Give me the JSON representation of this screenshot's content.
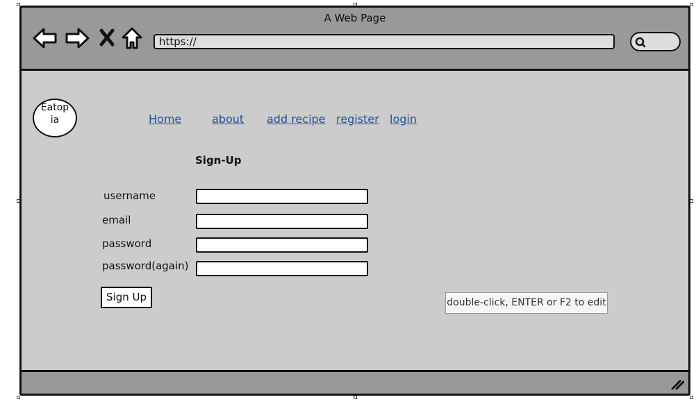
{
  "window": {
    "title": "A Web Page"
  },
  "toolbar": {
    "url": "https://",
    "icons": [
      "back-arrow-icon",
      "forward-arrow-icon",
      "close-x-icon",
      "home-icon",
      "search-icon"
    ]
  },
  "logo": {
    "text_line1": "Eatop",
    "text_line2": "ia"
  },
  "nav": {
    "home": "Home",
    "about": "about",
    "add_recipe": "add recipe",
    "register": "register",
    "login": "login"
  },
  "form": {
    "heading": "Sign-Up",
    "username_label": "username",
    "email_label": "email",
    "password_label": "password",
    "password_again_label": "password(again)",
    "username_value": "",
    "email_value": "",
    "password_value": "",
    "password_again_value": "",
    "submit_label": "Sign Up"
  },
  "tooltip": {
    "text": "double-click, ENTER or F2 to edit"
  },
  "colors": {
    "link": "#1f4e9a",
    "chrome": "#999999",
    "page": "#cccccc"
  }
}
